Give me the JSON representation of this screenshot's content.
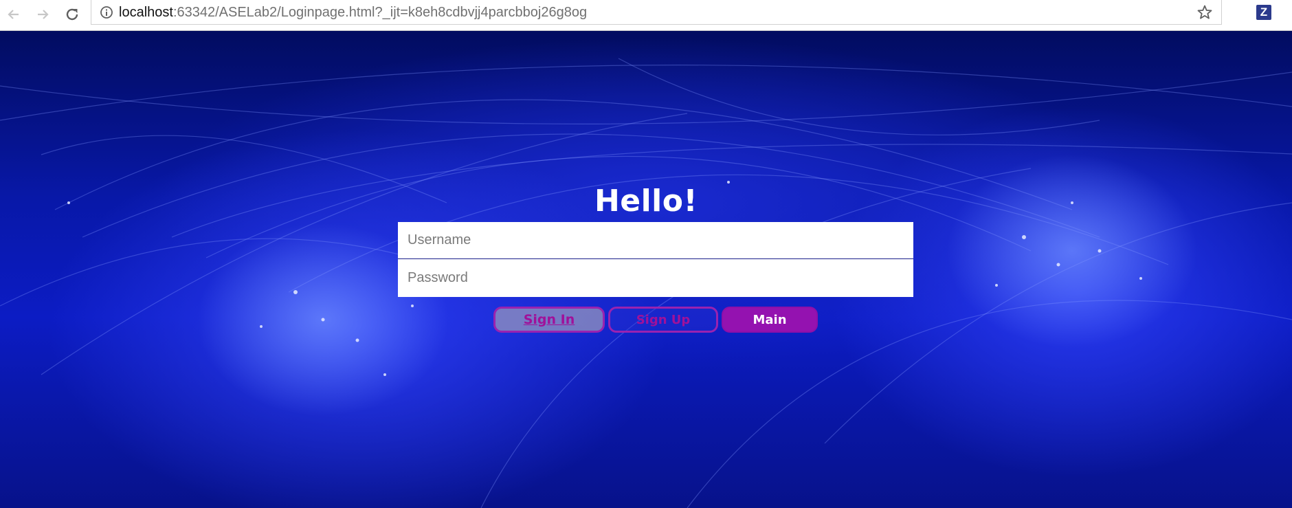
{
  "browser": {
    "url_host": "localhost",
    "url_path": ":63342/ASELab2/Loginpage.html?_ijt=k8eh8cdbvjj4parcbboj26g8og",
    "icons": {
      "back": "arrow-left-icon",
      "forward": "arrow-right-icon",
      "reload": "reload-icon",
      "info": "info-icon",
      "bookmark": "star-icon",
      "extension": "z-extension-icon"
    },
    "extension_label": "Z"
  },
  "login": {
    "heading": "Hello!",
    "username_placeholder": "Username",
    "password_placeholder": "Password",
    "signin_label": "Sign In",
    "signup_label": "Sign Up",
    "main_label": "Main"
  },
  "colors": {
    "button_accent": "#9412b0",
    "button_text": "#a0119a",
    "background_blue": "#0c1cc4"
  }
}
